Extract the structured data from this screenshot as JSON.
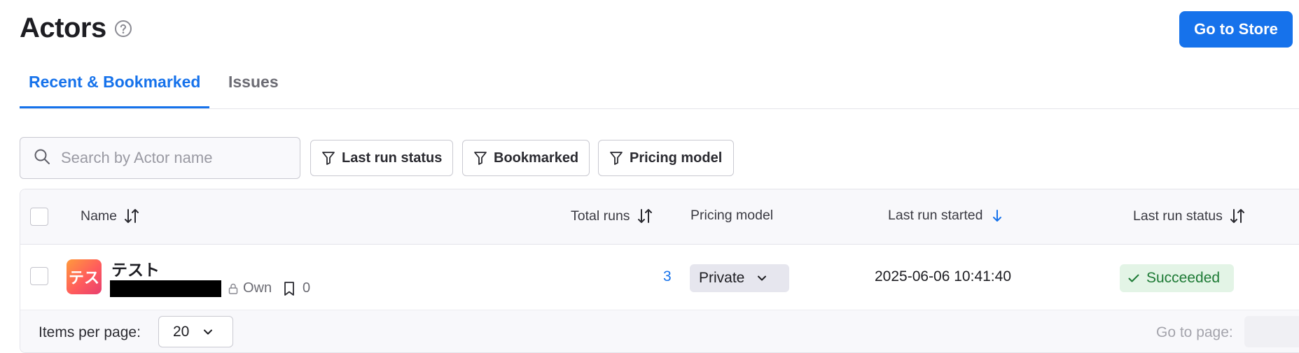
{
  "header": {
    "title": "Actors",
    "help_icon": "question-circle-icon",
    "store_button": "Go to Store"
  },
  "tabs": [
    {
      "label": "Recent & Bookmarked",
      "active": true
    },
    {
      "label": "Issues",
      "active": false
    }
  ],
  "filters": {
    "search_placeholder": "Search by Actor name",
    "buttons": [
      {
        "label": "Last run status",
        "icon": "filter-icon"
      },
      {
        "label": "Bookmarked",
        "icon": "filter-icon"
      },
      {
        "label": "Pricing model",
        "icon": "filter-icon"
      }
    ]
  },
  "table": {
    "columns": {
      "name": "Name",
      "total_runs": "Total runs",
      "pricing_model": "Pricing model",
      "last_run_started": "Last run started",
      "last_run_status": "Last run status"
    },
    "rows": [
      {
        "avatar_text": "テス",
        "name": "テスト",
        "ownership": "Own",
        "bookmarks": "0",
        "total_runs": "3",
        "pricing": "Private",
        "last_run_started": "2025-06-06 10:41:40",
        "status": "Succeeded"
      }
    ]
  },
  "footer": {
    "items_per_page_label": "Items per page:",
    "items_per_page_value": "20",
    "go_to_page_label": "Go to page:"
  },
  "colors": {
    "accent": "#1672eb",
    "success_bg": "#e3f4e6",
    "success_text": "#1d7a35"
  }
}
